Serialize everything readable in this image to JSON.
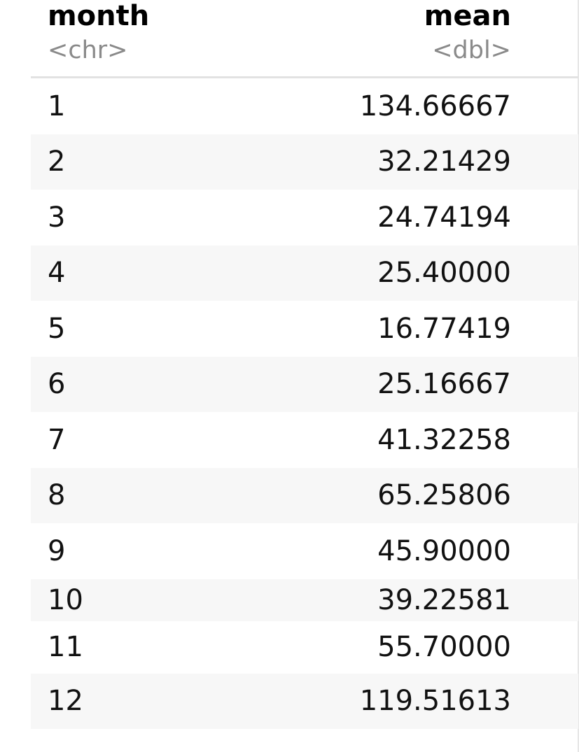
{
  "columns": [
    {
      "name": "month",
      "type": "<chr>"
    },
    {
      "name": "mean",
      "type": "<dbl>"
    }
  ],
  "rows": [
    {
      "month": "1",
      "mean": "134.66667"
    },
    {
      "month": "2",
      "mean": "32.21429"
    },
    {
      "month": "3",
      "mean": "24.74194"
    },
    {
      "month": "4",
      "mean": "25.40000"
    },
    {
      "month": "5",
      "mean": "16.77419"
    },
    {
      "month": "6",
      "mean": "25.16667"
    },
    {
      "month": "7",
      "mean": "41.32258"
    },
    {
      "month": "8",
      "mean": "65.25806"
    },
    {
      "month": "9",
      "mean": "45.90000"
    },
    {
      "month": "10",
      "mean": "39.22581"
    },
    {
      "month": "11",
      "mean": "55.70000"
    },
    {
      "month": "12",
      "mean": "119.51613"
    }
  ]
}
